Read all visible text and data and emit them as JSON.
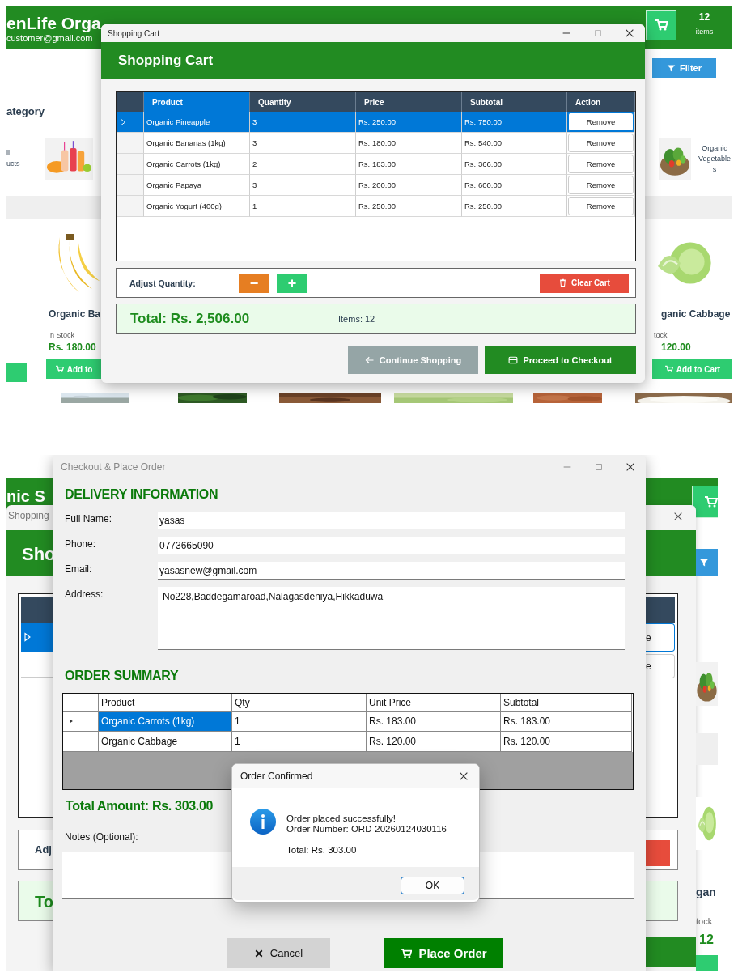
{
  "cart_screen": {
    "store": {
      "title": "enLife Orga",
      "email": "customer@gmail.com",
      "cart_count": "12",
      "cart_label": "items",
      "filter": "Filter",
      "category_heading": "ategory",
      "categories": [
        {
          "label": "ll\nucts",
          "kind": "text_first"
        },
        {
          "label": "Organic Vegetables",
          "kind": "picture_first"
        }
      ],
      "products": [
        {
          "name": "Organic Ba",
          "stock": "n Stock",
          "price": "Rs. 180.00",
          "button": "Add to"
        },
        {
          "name": "ganic Cabbage",
          "stock": "tock",
          "price": "120.00",
          "button": "Add to Cart"
        }
      ]
    },
    "dialog": {
      "window_title": "Shopping Cart",
      "heading": "Shopping Cart",
      "grid": {
        "columns": [
          {
            "label": "Product",
            "selected": true
          },
          {
            "label": "Quantity",
            "selected": false
          },
          {
            "label": "Price",
            "selected": false
          },
          {
            "label": "Subtotal",
            "selected": false
          },
          {
            "label": "Action",
            "selected": false
          }
        ],
        "rows": [
          {
            "product": "Organic Pineapple",
            "quantity": "3",
            "price": "Rs. 250.00",
            "subtotal": "Rs. 750.00",
            "action": "Remove",
            "selected": true
          },
          {
            "product": "Organic Bananas (1kg)",
            "quantity": "3",
            "price": "Rs. 180.00",
            "subtotal": "Rs. 540.00",
            "action": "Remove",
            "selected": false
          },
          {
            "product": "Organic Carrots (1kg)",
            "quantity": "2",
            "price": "Rs. 183.00",
            "subtotal": "Rs. 366.00",
            "action": "Remove",
            "selected": false
          },
          {
            "product": "Organic Papaya",
            "quantity": "3",
            "price": "Rs. 200.00",
            "subtotal": "Rs. 600.00",
            "action": "Remove",
            "selected": false
          },
          {
            "product": "Organic Yogurt (400g)",
            "quantity": "1",
            "price": "Rs. 250.00",
            "subtotal": "Rs. 250.00",
            "action": "Remove",
            "selected": false
          }
        ]
      },
      "adjust_label": "Adjust Quantity:",
      "decrease": "−",
      "increase": "+",
      "clear": "Clear Cart",
      "total": "Total: Rs. 2,506.00",
      "items": "Items: 12",
      "continue": "Continue Shopping",
      "checkout": "Proceed to Checkout"
    }
  },
  "checkout_screen": {
    "background": {
      "store_title": "nic S",
      "cart_window_title": "Shopping",
      "cart_heading": "Sho",
      "remove_fragments": [
        "e",
        "e"
      ],
      "adjust_fragment": "Adj",
      "total_fragment": "To",
      "product_fragment": "gan",
      "stock_fragment": "tock",
      "price_fragment": "12"
    },
    "checkout": {
      "window_title": "Checkout & Place Order",
      "delivery_heading": "DELIVERY INFORMATION",
      "fields": [
        {
          "label": "Full Name:",
          "value": "yasas",
          "kind": "line"
        },
        {
          "label": "Phone:",
          "value": "0773665090",
          "kind": "line"
        },
        {
          "label": "Email:",
          "value": "yasasnew@gmail.com",
          "kind": "line"
        },
        {
          "label": "Address:",
          "value": "No228,Baddegamaroad,Nalagasdeniya,Hikkaduwa",
          "kind": "multiline"
        }
      ],
      "summary_heading": "ORDER SUMMARY",
      "grid": {
        "columns": [
          "Product",
          "Qty",
          "Unit Price",
          "Subtotal"
        ],
        "rows": [
          {
            "product": "Organic Carrots (1kg)",
            "qty": "1",
            "unit_price": "Rs. 183.00",
            "subtotal": "Rs. 183.00",
            "selected": true
          },
          {
            "product": "Organic Cabbage",
            "qty": "1",
            "unit_price": "Rs. 120.00",
            "subtotal": "Rs. 120.00",
            "selected": false
          }
        ]
      },
      "total": "Total Amount: Rs. 303.00",
      "notes_label": "Notes (Optional):",
      "cancel": "Cancel",
      "place_order": "Place Order"
    },
    "message_box": {
      "title": "Order Confirmed",
      "lines": [
        "Order placed successfully!",
        "Order Number: ORD-20260124030116"
      ],
      "total": "Total: Rs. 303.00",
      "ok": "OK"
    }
  }
}
